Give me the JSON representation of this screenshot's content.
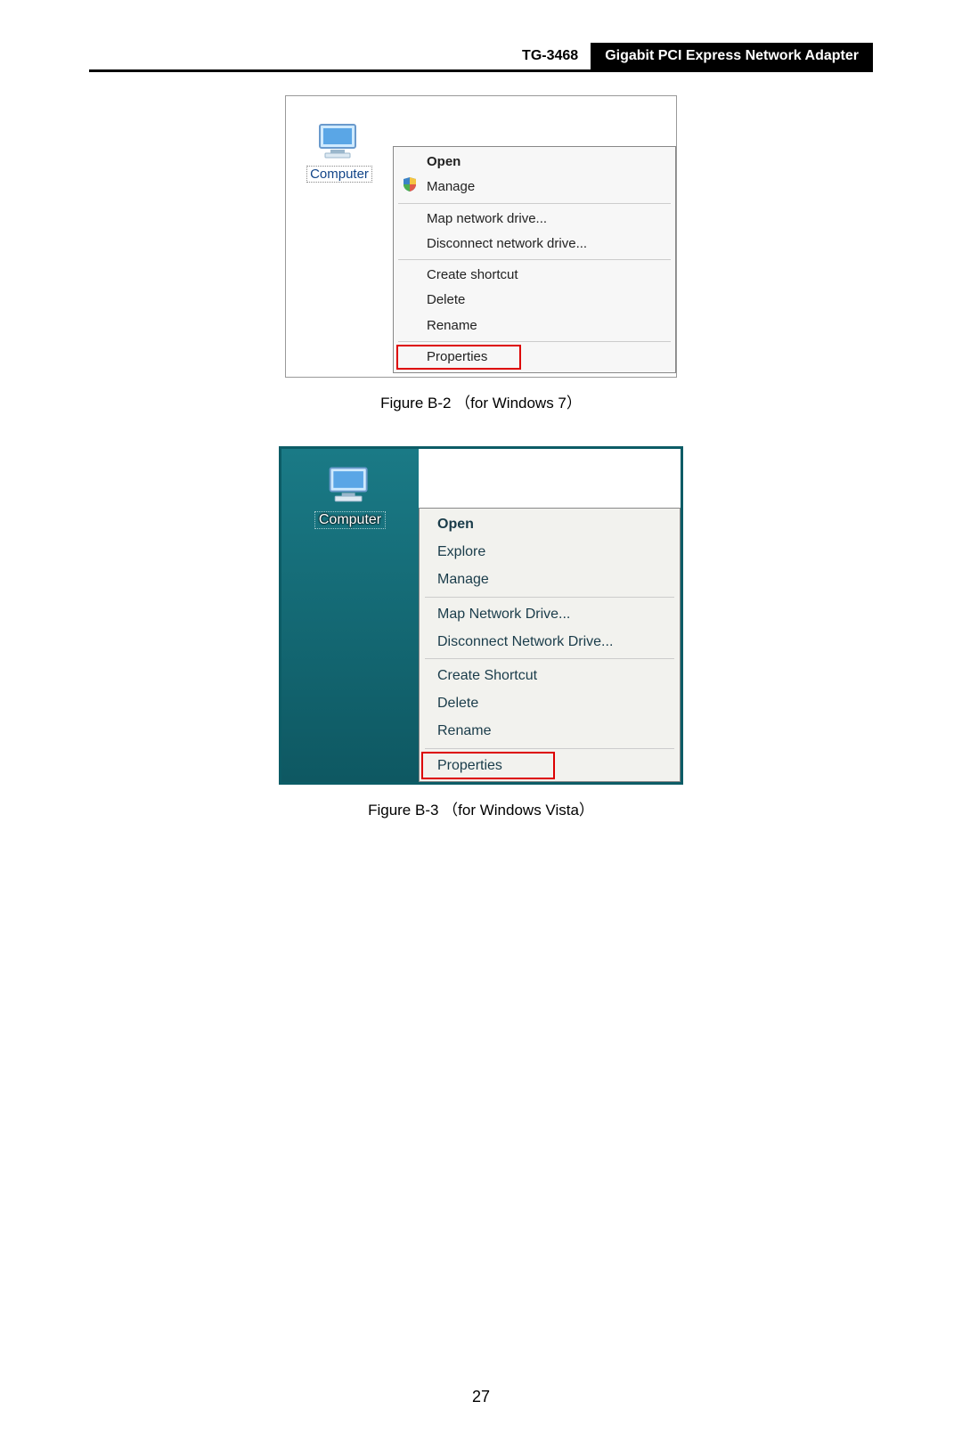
{
  "header": {
    "model": "TG-3468",
    "title": "Gigabit PCI Express Network Adapter"
  },
  "fig_b2": {
    "icon_label": "Computer",
    "menu": {
      "open": "Open",
      "manage": "Manage",
      "map": "Map network drive...",
      "disconnect": "Disconnect network drive...",
      "shortcut": "Create shortcut",
      "delete": "Delete",
      "rename": "Rename",
      "properties": "Properties"
    },
    "caption": "Figure B-2  （for Windows 7）"
  },
  "fig_b3": {
    "icon_label": "Computer",
    "menu": {
      "open": "Open",
      "explore": "Explore",
      "manage": "Manage",
      "map": "Map Network Drive...",
      "disconnect": "Disconnect Network Drive...",
      "shortcut": "Create Shortcut",
      "delete": "Delete",
      "rename": "Rename",
      "properties": "Properties"
    },
    "caption": "Figure B-3  （for Windows Vista）"
  },
  "page_number": "27"
}
